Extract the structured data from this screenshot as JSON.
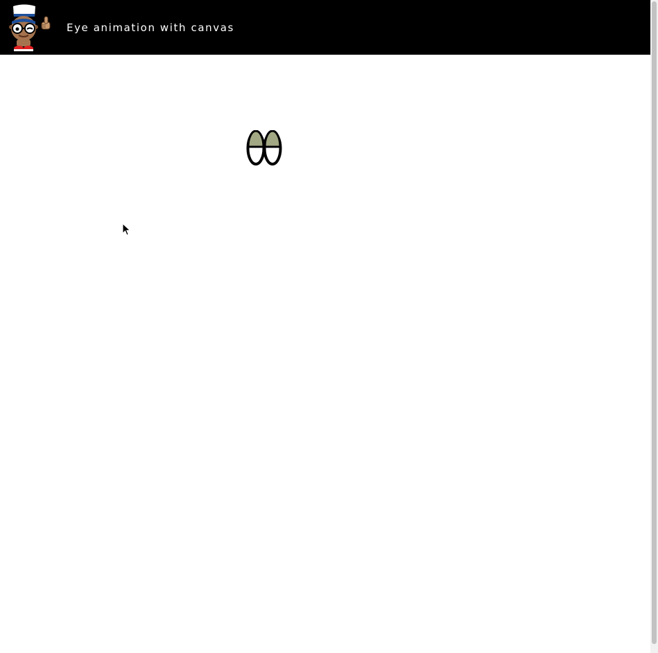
{
  "header": {
    "title": "Eye animation with canvas",
    "logo_icon": "thumbs-up-avatar-icon",
    "background": "#000000",
    "text_color": "#ffffff"
  },
  "canvas": {
    "eyes_icon": "eyes-icon",
    "iris_color": "#a3a884",
    "outline_color": "#000000"
  },
  "cursor_icon": "mouse-pointer-icon"
}
